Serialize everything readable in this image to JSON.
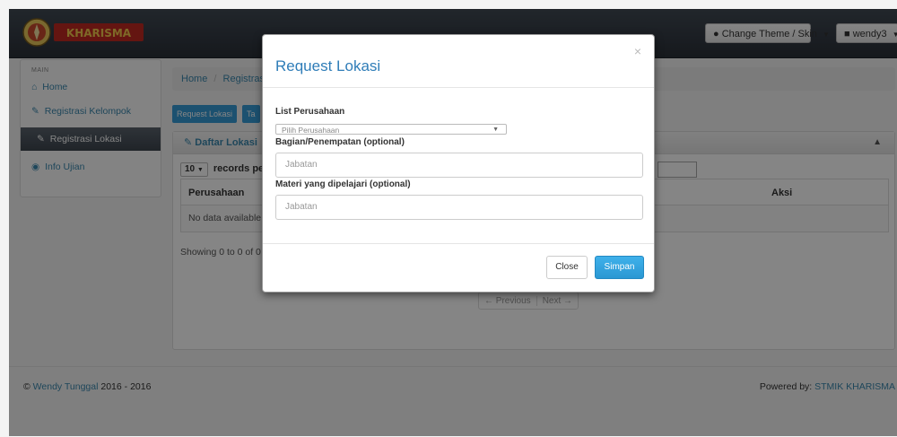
{
  "brand": {
    "name": "KHARISMA",
    "logo_text": "KHARISMA"
  },
  "navbar": {
    "theme_button": "Change Theme / Skin",
    "user_button": "wendy3"
  },
  "sidebar": {
    "section": "MAIN",
    "items": [
      {
        "label": "Home",
        "icon": "home-icon"
      },
      {
        "label": "Registrasi Kelompok",
        "icon": "edit-icon"
      },
      {
        "label": "Registrasi Lokasi",
        "icon": "edit-icon",
        "active": true
      },
      {
        "label": "Info Ujian",
        "icon": "eye-icon"
      }
    ]
  },
  "breadcrumb": {
    "home": "Home",
    "current": "Registras"
  },
  "toolbar": {
    "request_label": "Request Lokasi",
    "second_label": "Ta"
  },
  "panel": {
    "title": "Daftar Lokasi",
    "records_value": "10",
    "records_label": "records pe",
    "columns": [
      "Perusahaan",
      "Aksi"
    ],
    "empty_text": "No data available i",
    "showing": "Showing 0 to 0 of 0",
    "prev": "← Previous",
    "next": "Next →"
  },
  "footer": {
    "copyright_prefix": "©",
    "author": "Wendy Tunggal",
    "years": "2016 - 2016",
    "powered_label": "Powered by:",
    "powered_link": "STMIK KHARISMA"
  },
  "modal": {
    "title": "Request Lokasi",
    "close_symbol": "×",
    "company_label": "List Perusahaan",
    "company_placeholder": "Pilih Perusahaan",
    "division_label": "Bagian/Penempatan (optional)",
    "division_placeholder": "Jabatan",
    "material_label": "Materi yang dipelajari (optional)",
    "material_placeholder": "Jabatan",
    "close_label": "Close",
    "save_label": "Simpan"
  },
  "colors": {
    "accent": "#2f7db8",
    "primary_button": "#2a97d3",
    "navbar": "#2a3038"
  }
}
